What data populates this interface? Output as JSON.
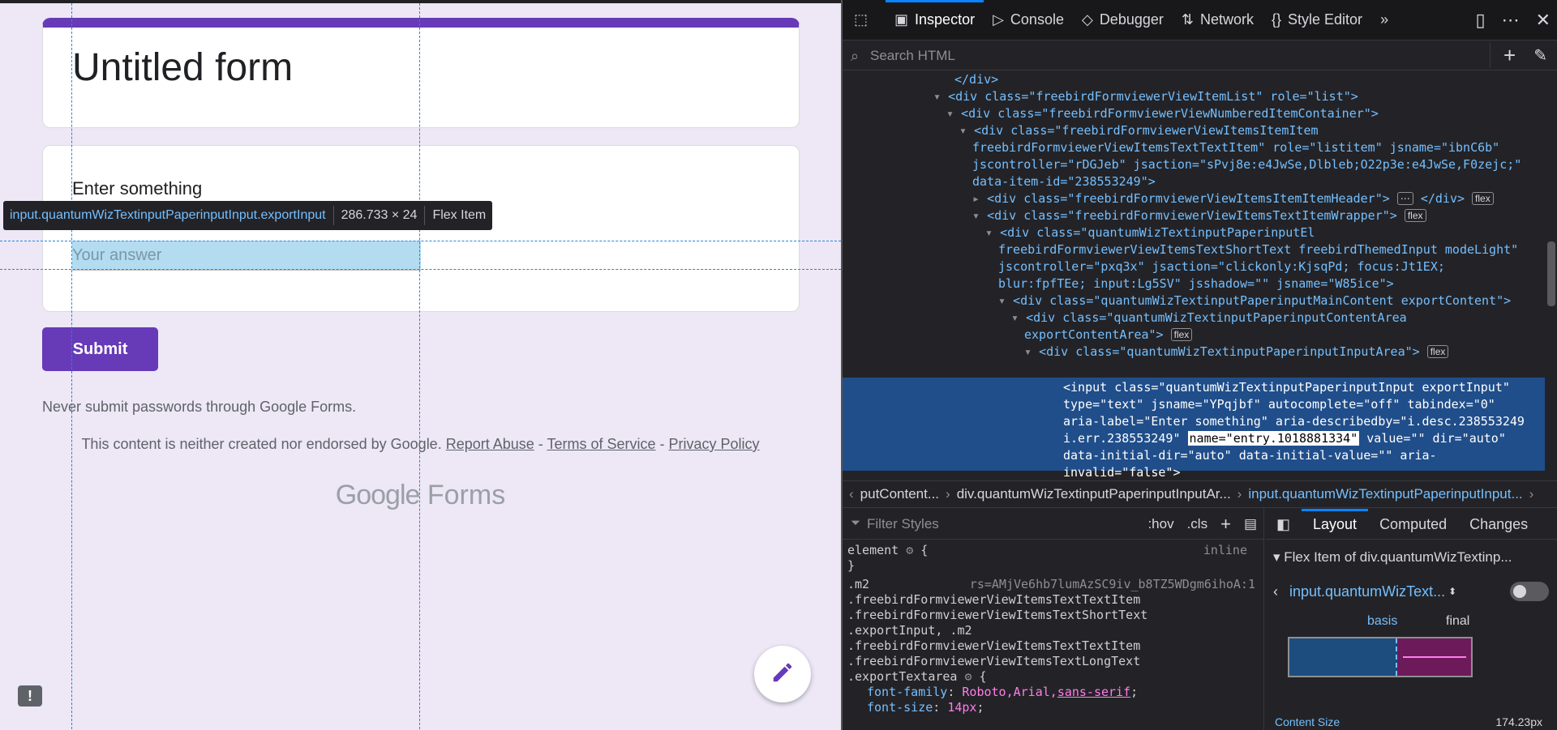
{
  "form": {
    "title": "Untitled form",
    "question_label": "Enter something",
    "answer_placeholder": "Your answer",
    "submit_label": "Submit",
    "password_warning": "Never submit passwords through Google Forms.",
    "footer_text": "This content is neither created nor endorsed by Google.",
    "footer_links": [
      "Report Abuse",
      "Terms of Service",
      "Privacy Policy"
    ],
    "footer_sep": " - ",
    "logo_google": "Google",
    "logo_forms": "Forms",
    "accent_color": "#673ab7"
  },
  "tooltip": {
    "selector": "input.quantumWizTextinputPaperinputInput.exportInput",
    "size": "286.733 × 24",
    "role": "Flex Item"
  },
  "devtools": {
    "tabs": [
      "Inspector",
      "Console",
      "Debugger",
      "Network",
      "Style Editor"
    ],
    "search_placeholder": "Search HTML",
    "markup": [
      "</div>",
      "<div class=\"freebirdFormviewerViewItemList\" role=\"list\">",
      "<div class=\"freebirdFormviewerViewNumberedItemContainer\">",
      "<div class=\"freebirdFormviewerViewItemsItemItem",
      "freebirdFormviewerViewItemsTextTextItem\" role=\"listitem\" jsname=\"ibnC6b\"",
      "jscontroller=\"rDGJeb\" jsaction=\"sPvj8e:e4JwSe,Dlbleb;O22p3e:e4JwSe,F0zejc;\"",
      "data-item-id=\"238553249\">",
      "<div class=\"freebirdFormviewerViewItemsItemItemHeader\">",
      "<div class=\"freebirdFormviewerViewItemsTextItemWrapper\">",
      "<div class=\"quantumWizTextinputPaperinputEl",
      "freebirdFormviewerViewItemsTextShortText freebirdThemedInput modeLight\"",
      "jscontroller=\"pxq3x\" jsaction=\"clickonly:KjsqPd; focus:Jt1EX;",
      "blur:fpfTEe; input:Lg5SV\" jsshadow=\"\" jsname=\"W85ice\">",
      "<div class=\"quantumWizTextinputPaperinputMainContent exportContent\">",
      "<div class=\"quantumWizTextinputPaperinputContentArea",
      "exportContentArea\">",
      "<div class=\"quantumWizTextinputPaperinputInputArea\">"
    ],
    "selected_markup": [
      "<input class=\"quantumWizTextinputPaperinputInput exportInput\"",
      "type=\"text\" jsname=\"YPqjbf\" autocomplete=\"off\" tabindex=\"0\"",
      "aria-label=\"Enter something\" aria-describedby=\"i.desc.238553249",
      "i.err.238553249\"",
      "name=\"entry.1018881334\"",
      " value=\"\" dir=\"auto\"",
      "data-initial-dir=\"auto\" data-initial-value=\"\" aria-",
      "invalid=\"false\">"
    ],
    "badge_flex": "flex",
    "breadcrumbs": [
      "putContent...",
      "div.quantumWizTextinputPaperinputInputAr...",
      "input.quantumWizTextinputPaperinputInput..."
    ],
    "filter_placeholder": "Filter Styles",
    "styles_buttons": [
      ":hov",
      ".cls"
    ],
    "css_lines": [
      "element",
      "inline",
      ".m2",
      "rs=AMjVe6hb7lumAzSC9iv_b8TZ5WDgm6ihoA:1",
      ".freebirdFormviewerViewItemsTextTextItem",
      ".freebirdFormviewerViewItemsTextShortText",
      ".exportInput, .m2",
      ".freebirdFormviewerViewItemsTextTextItem",
      ".freebirdFormviewerViewItemsTextLongText",
      ".exportTextarea",
      "font-family",
      "Roboto,Arial,",
      "sans-serif",
      "font-size",
      "14px"
    ],
    "layout_tabs": [
      "Layout",
      "Computed",
      "Changes"
    ],
    "flex_header": "Flex Item of div.quantumWizTextinp...",
    "flex_item_select": "input.quantumWizText...",
    "flex_basis": "basis",
    "flex_final": "final",
    "content_size": "Content Size",
    "content_size_value": "174.23px"
  }
}
